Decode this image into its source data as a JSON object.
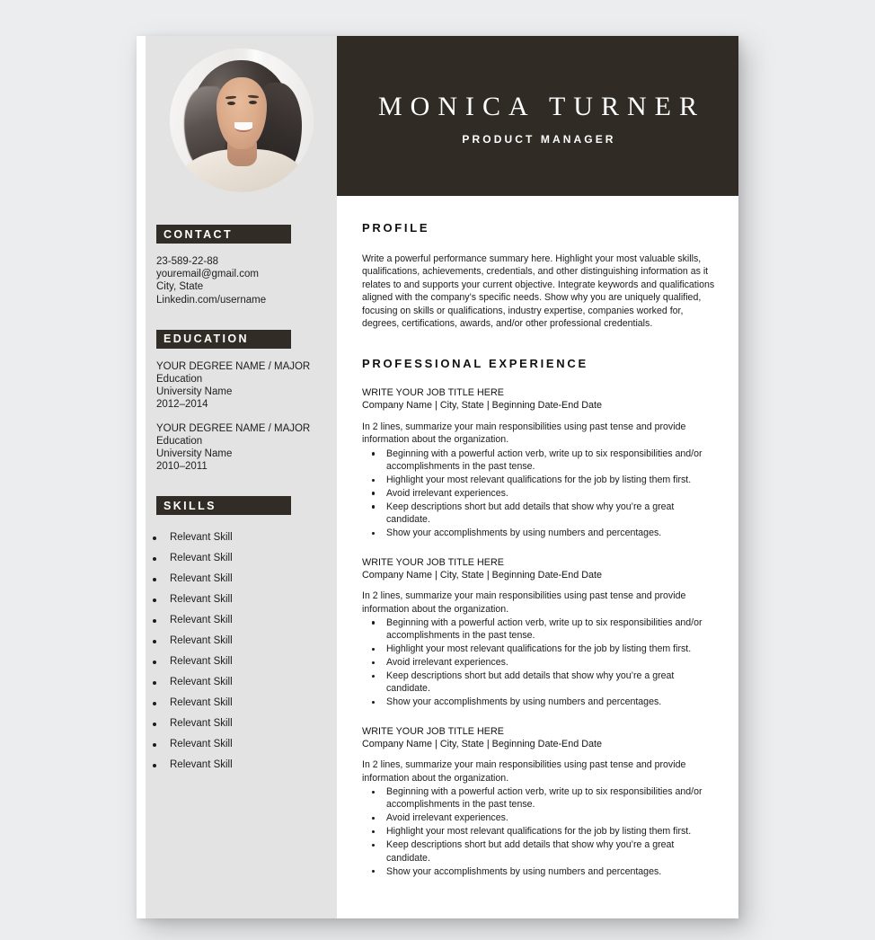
{
  "page": {
    "background_color": "#ecedee",
    "sheet_color": "#ffffff",
    "sidebar_color": "#e3e3e3",
    "accent_dark": "#302c25"
  },
  "header": {
    "name": "MONICA TURNER",
    "role": "PRODUCT MANAGER"
  },
  "photo": {
    "alt": "profile-photo"
  },
  "sidebar": {
    "contact": {
      "heading": "CONTACT",
      "phone": "23-589-22-88",
      "email": "youremail@gmail.com",
      "location": "City, State",
      "linkedin": "Linkedin.com/username"
    },
    "education": {
      "heading": "EDUCATION",
      "entries": [
        {
          "degree": "YOUR DEGREE NAME / MAJOR",
          "level": "Education",
          "school": "University Name",
          "years": "2012–2014"
        },
        {
          "degree": "YOUR DEGREE NAME / MAJOR",
          "level": "Education",
          "school": "University Name",
          "years": "2010–2011"
        }
      ]
    },
    "skills": {
      "heading": "SKILLS",
      "items": [
        "Relevant Skill",
        "Relevant Skill",
        "Relevant Skill",
        "Relevant Skill",
        "Relevant Skill",
        "Relevant Skill",
        "Relevant Skill",
        "Relevant Skill",
        "Relevant Skill",
        "Relevant Skill",
        "Relevant Skill",
        "Relevant Skill"
      ]
    }
  },
  "main": {
    "profile": {
      "heading": "PROFILE",
      "text": "Write a powerful performance summary here. Highlight your most valuable skills, qualifications, achievements, credentials, and other distinguishing information as it relates to and supports your current objective. Integrate keywords and qualifications aligned with the company’s specific needs. Show why you are uniquely qualified, focusing on skills or qualifications, industry expertise, companies worked for, degrees, certifications, awards, and/or other professional credentials."
    },
    "experience": {
      "heading": "PROFESSIONAL EXPERIENCE",
      "jobs": [
        {
          "title": "WRITE YOUR JOB TITLE HERE",
          "meta": "Company Name | City, State | Beginning Date-End Date",
          "summary": "In 2 lines, summarize your main responsibilities using past tense and provide information about the organization.",
          "bullets": [
            "Beginning with a powerful action verb, write up to six responsibilities and/or accomplishments in the past tense.",
            "Highlight your most relevant qualifications for the job by listing them first.",
            "Avoid irrelevant experiences.",
            "Keep descriptions short but add details that show why you’re a great candidate.",
            "Show your accomplishments by using numbers and percentages."
          ]
        },
        {
          "title": "WRITE YOUR JOB TITLE HERE",
          "meta": "Company Name | City, State | Beginning Date-End Date",
          "summary": "In 2 lines, summarize your main responsibilities using past tense and provide information about the organization.",
          "bullets": [
            "Beginning with a powerful action verb, write up to six responsibilities and/or accomplishments in the past tense.",
            "Highlight your most relevant qualifications for the job by listing them first.",
            "Avoid irrelevant experiences.",
            "Keep descriptions short but add details that show why you’re a great candidate.",
            "Show your accomplishments by using numbers and percentages."
          ]
        },
        {
          "title": "WRITE YOUR JOB TITLE HERE",
          "meta": "Company Name | City, State | Beginning Date-End Date",
          "summary": "In 2 lines, summarize your main responsibilities using past tense and provide information about the organization.",
          "bullets": [
            "Beginning with a powerful action verb, write up to six responsibilities and/or accomplishments in the past tense.",
            "Avoid irrelevant experiences.",
            "Highlight your most relevant qualifications for the job by listing them first.",
            "Keep descriptions short but add details that show why you’re a great candidate.",
            "Show your accomplishments by using numbers and percentages."
          ]
        }
      ]
    }
  }
}
